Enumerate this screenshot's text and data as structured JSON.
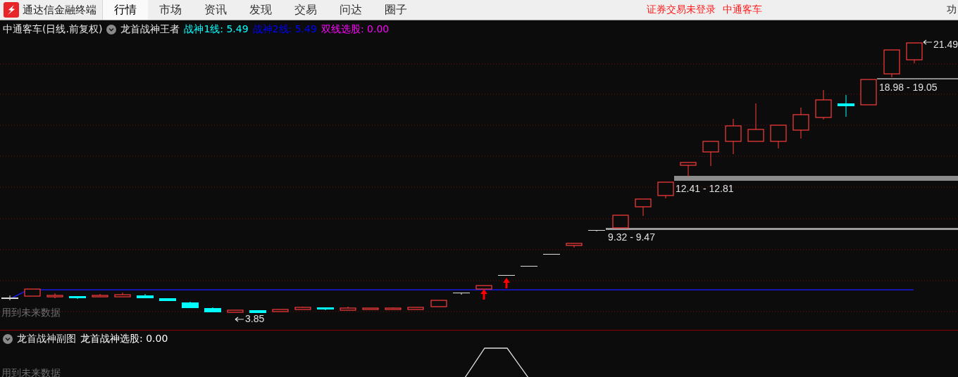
{
  "app": {
    "title": "通达信金融终端"
  },
  "menu": [
    {
      "label": "行情",
      "selected": true
    },
    {
      "label": "市场",
      "selected": false
    },
    {
      "label": "资讯",
      "selected": false
    },
    {
      "label": "发现",
      "selected": false
    },
    {
      "label": "交易",
      "selected": false
    },
    {
      "label": "问达",
      "selected": false
    },
    {
      "label": "圈子",
      "selected": false
    }
  ],
  "status": [
    "证券交易未登录",
    "中通客车"
  ],
  "corner_menu": "功",
  "main_chart": {
    "title": "中通客车(日线.前复权)",
    "indicator": "龙首战神王者",
    "readings": [
      {
        "label": "战神1线: 5.49",
        "color": "#00ffff"
      },
      {
        "label": "战神2线: 5.49",
        "color": "#0000ff"
      },
      {
        "label": "双线选股: 0.00",
        "color": "#ff00ff"
      }
    ],
    "warning": "用到未来数据",
    "price_labels": [
      {
        "text": "21.49",
        "kind": "high"
      },
      {
        "text": "18.98 - 19.05",
        "kind": "zone"
      },
      {
        "text": "12.41 - 12.81",
        "kind": "zone"
      },
      {
        "text": "9.32 - 9.47",
        "kind": "zone"
      },
      {
        "text": "3.85",
        "kind": "low"
      }
    ]
  },
  "sub_chart": {
    "title": "龙首战神副图",
    "readings": [
      {
        "label": "龙首战神选股: 0.00",
        "color": "#ffffff"
      }
    ],
    "warning": "用到未来数据"
  }
}
